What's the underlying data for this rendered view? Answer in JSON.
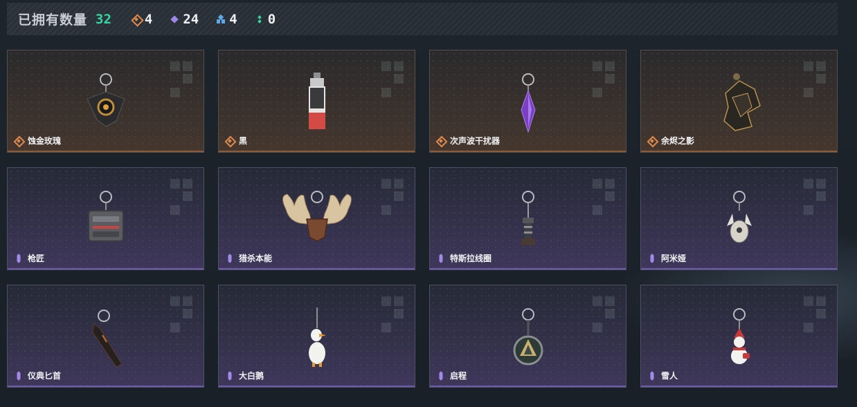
{
  "summary": {
    "owned_label": "已拥有数量",
    "owned_count": "32",
    "stats": [
      {
        "icon": "orange-diamond-icon",
        "color": "#e08a4c",
        "value": "4"
      },
      {
        "icon": "purple-diamond-icon",
        "color": "#9f86e6",
        "value": "24"
      },
      {
        "icon": "blue-diamond-icon",
        "color": "#5fa8e8",
        "value": "4"
      },
      {
        "icon": "green-diamond-icon",
        "color": "#35d6a0",
        "value": "0"
      }
    ]
  },
  "items": [
    {
      "name": "蚀金玫瑰",
      "rarity": "orange"
    },
    {
      "name": "黑",
      "rarity": "orange"
    },
    {
      "name": "次声波干扰器",
      "rarity": "orange"
    },
    {
      "name": "余烬之影",
      "rarity": "orange"
    },
    {
      "name": "枪匠",
      "rarity": "purple"
    },
    {
      "name": "猎杀本能",
      "rarity": "purple"
    },
    {
      "name": "特斯拉线圈",
      "rarity": "purple"
    },
    {
      "name": "阿米娅",
      "rarity": "purple"
    },
    {
      "name": "仪典匕首",
      "rarity": "purple"
    },
    {
      "name": "大白鹅",
      "rarity": "purple"
    },
    {
      "name": "启程",
      "rarity": "purple"
    },
    {
      "name": "雪人",
      "rarity": "purple"
    }
  ]
}
